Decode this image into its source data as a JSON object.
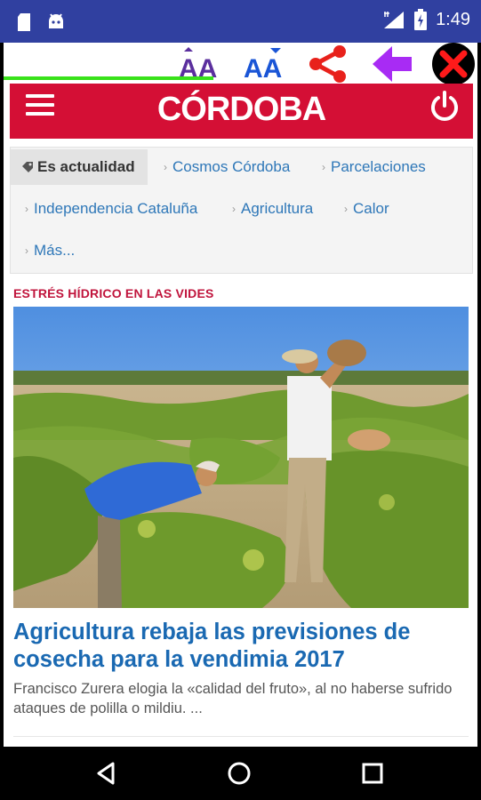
{
  "status_bar": {
    "time": "1:49",
    "icons": [
      "sd-card-icon",
      "android-icon",
      "signal-icon",
      "battery-icon"
    ]
  },
  "toolbar": {
    "buttons": [
      {
        "name": "font-increase-icon",
        "color": "#5b2f9e"
      },
      {
        "name": "font-decrease-icon",
        "color": "#1a55d6"
      },
      {
        "name": "share-icon",
        "color": "#e8211b"
      },
      {
        "name": "back-arrow-icon",
        "color": "#a82bf4"
      },
      {
        "name": "close-icon",
        "color": "#ff1a1a"
      }
    ],
    "font_large_label": "AA",
    "font_small_label": "AA"
  },
  "header": {
    "logo": "CÓRDOBA",
    "brand_color": "#d40f35"
  },
  "tags": {
    "active": "Es actualidad",
    "items": [
      "Cosmos Córdoba",
      "Parcelaciones",
      "Independencia Cataluña",
      "Agricultura",
      "Calor",
      "Más..."
    ]
  },
  "article": {
    "kicker": "ESTRÉS HÍDRICO EN LAS VIDES",
    "headline": "Agricultura rebaja las previsiones de cosecha para la vendimia 2017",
    "summary": "Francisco Zurera elogia la «calidad del fruto», al no haberse sufrido ataques de polilla o mildiu. ..."
  },
  "nav": {
    "buttons": [
      "back-triangle-icon",
      "home-circle-icon",
      "recents-square-icon"
    ]
  }
}
